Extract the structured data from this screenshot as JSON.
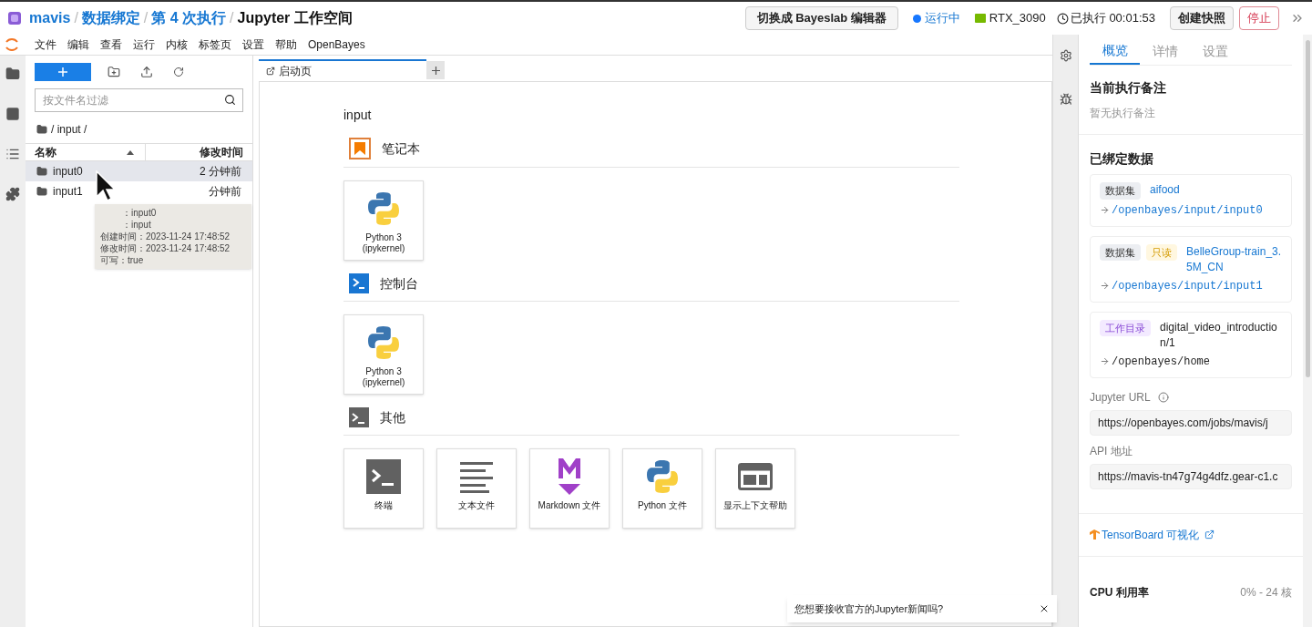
{
  "header": {
    "breadcrumb": [
      {
        "label": "mavis",
        "link": true
      },
      {
        "label": "数据绑定",
        "link": true
      },
      {
        "label": "第 4 次执行",
        "link": true
      },
      {
        "label": "Jupyter 工作空间",
        "link": false
      }
    ],
    "separator": "/",
    "switch_button": "切换成 Bayeslab 编辑器",
    "status": {
      "label": "运行中",
      "color": "#1677ff"
    },
    "gpu": "RTX_3090",
    "elapsed": "已执行 00:01:53",
    "snapshot_button": "创建快照",
    "stop_button": "停止"
  },
  "menu": [
    "文件",
    "编辑",
    "查看",
    "运行",
    "内核",
    "标签页",
    "设置",
    "帮助",
    "OpenBayes"
  ],
  "file_browser": {
    "filter_placeholder": "按文件名过滤",
    "path": "/ input /",
    "columns": [
      "名称",
      "修改时间"
    ],
    "rows": [
      {
        "name": "input0",
        "modified": "2 分钟前",
        "selected": true
      },
      {
        "name": "input1",
        "modified": "分钟前",
        "selected": false
      }
    ],
    "tooltip": [
      "：input0",
      "：input",
      "创建时间：2023-11-24 17:48:52",
      "修改时间：2023-11-24 17:48:52",
      "可写：true"
    ]
  },
  "tabs": [
    {
      "label": "启动页",
      "selected": true
    }
  ],
  "launcher": {
    "title": "input",
    "sections": [
      {
        "kind": "notebook",
        "title": "笔记本",
        "cards": [
          {
            "kind": "python",
            "label": "Python 3 (ipykernel)"
          }
        ]
      },
      {
        "kind": "console",
        "title": "控制台",
        "cards": [
          {
            "kind": "python",
            "label": "Python 3 (ipykernel)"
          }
        ]
      },
      {
        "kind": "other",
        "title": "其他",
        "cards": [
          {
            "kind": "terminal",
            "label": "终端"
          },
          {
            "kind": "text",
            "label": "文本文件"
          },
          {
            "kind": "markdown",
            "label": "Markdown 文件"
          },
          {
            "kind": "python",
            "label": "Python 文件"
          },
          {
            "kind": "help",
            "label": "显示上下文帮助"
          }
        ]
      }
    ]
  },
  "notification": "您想要接收官方的Jupyter新闻吗?",
  "panel": {
    "tabs": [
      {
        "label": "概览",
        "selected": true
      },
      {
        "label": "详情",
        "selected": false
      },
      {
        "label": "设置",
        "selected": false
      }
    ],
    "note_title": "当前执行备注",
    "note_text": "暂无执行备注",
    "bound_title": "已绑定数据",
    "bindings": [
      {
        "tags": [
          {
            "kind": "dataset",
            "label": "数据集"
          }
        ],
        "name": "aifood",
        "path": "/openbayes/input/input0",
        "link": true
      },
      {
        "tags": [
          {
            "kind": "dataset",
            "label": "数据集"
          },
          {
            "kind": "readonly",
            "label": "只读"
          }
        ],
        "name": "BelleGroup-train_3.5M_CN",
        "path": "/openbayes/input/input1",
        "link": true
      },
      {
        "tags": [
          {
            "kind": "workdir",
            "label": "工作目录"
          }
        ],
        "name": "digital_video_introduction/1",
        "path": "/openbayes/home",
        "link": false
      }
    ],
    "jupyter_url_label": "Jupyter URL",
    "jupyter_url": "https://openbayes.com/jobs/mavis/j",
    "api_label": "API 地址",
    "api_url": "https://mavis-tn47g74g4dfz.gear-c1.c",
    "tensorboard": "TensorBoard 可视化",
    "cpu_label": "CPU 利用率",
    "cpu_value": "0% - 24 核"
  }
}
